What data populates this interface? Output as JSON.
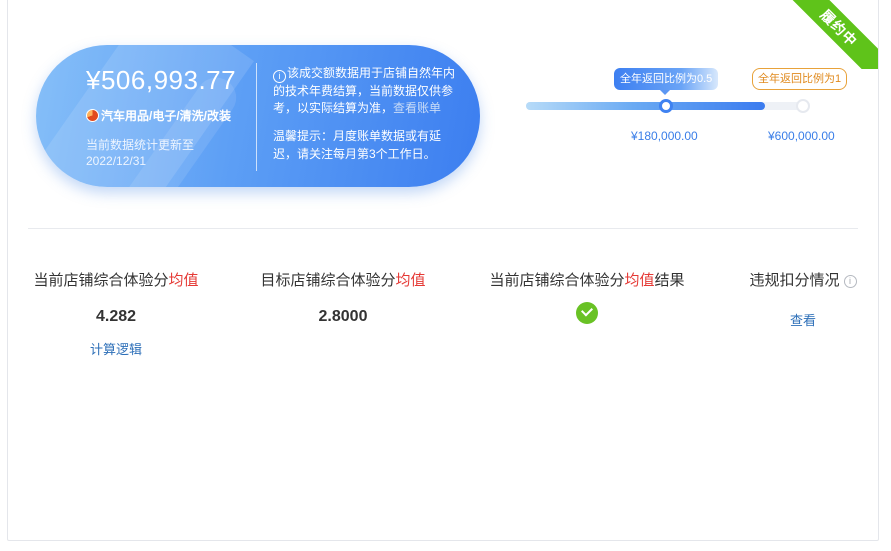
{
  "ribbon": {
    "label": "履约中"
  },
  "summary": {
    "amount": "¥506,993.77",
    "category": "汽车用品/电子/清洗/改装",
    "updated_text": "当前数据统计更新至 2022/12/31",
    "notice_text": "该成交额数据用于店铺自然年内的技术年费结算，当前数据仅供参考，以实际结算为准，",
    "notice_link": "查看账单",
    "tip_text": "温馨提示：月度账单数据或有延迟，请关注每月第3个工作日。"
  },
  "progress": {
    "current_bubble": "全年返回比例为0.5",
    "target_bubble": "全年返回比例为1",
    "tick_current": "¥180,000.00",
    "tick_target": "¥600,000.00",
    "fill_fraction": 0.855
  },
  "metrics": [
    {
      "label_prefix": "当前店铺综合体验分",
      "label_highlight": "均值",
      "label_suffix": "",
      "value": "4.282",
      "link": "计算逻辑"
    },
    {
      "label_prefix": "目标店铺综合体验分",
      "label_highlight": "均值",
      "label_suffix": "",
      "value": "2.8000"
    },
    {
      "label_prefix": "当前店铺综合体验分",
      "label_highlight": "均值",
      "label_suffix": "结果",
      "status": "passed"
    },
    {
      "label_prefix": "违规扣分情况",
      "link": "查看"
    }
  ],
  "icons": {
    "pie": "pie-chart-icon",
    "info": "info-icon",
    "check": "check-circle-icon",
    "help": "question-circle-icon"
  },
  "colors": {
    "ribbon": "#5fc31a",
    "accent": "#3c7ef0",
    "highlight": "#e53935",
    "link": "#2d6fb8",
    "success": "#69c225",
    "target": "#e08a1e"
  }
}
